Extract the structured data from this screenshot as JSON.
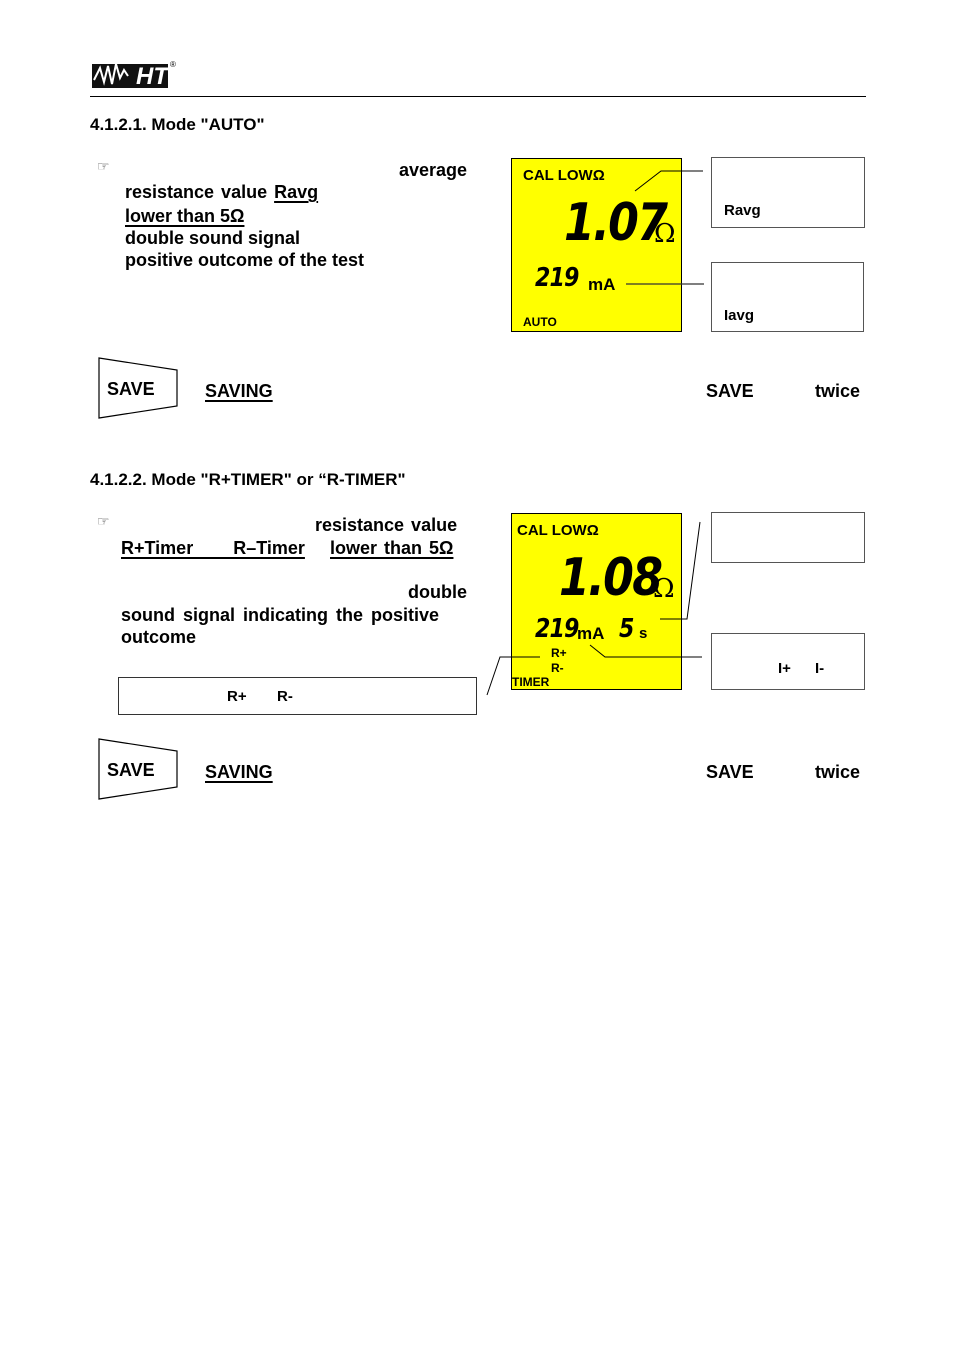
{
  "header": {
    "logo_text": "HT",
    "logo_mark": "®"
  },
  "section1": {
    "heading": "4.1.2.1.    Mode \"AUTO\"",
    "note_icon": "pointing-hand-icon",
    "paragraph": {
      "line1": "average",
      "line2a": "resistance  value ",
      "line2b": "Ravg",
      "line3": "lower  than  5Ω",
      "line4": "double   sound   signal",
      "line5": "positive   outcome   of   the   test"
    },
    "lcd": {
      "mode_label": "CAL LOWΩ",
      "resistance_value": "1.07",
      "resistance_unit": "Ω",
      "current_value": "219",
      "current_unit": "mA",
      "footer_label": "AUTO",
      "background_color": "#ffff00"
    },
    "callouts": [
      {
        "label": "Ravg"
      },
      {
        "label": "Iavg"
      }
    ],
    "save_row": {
      "key_label": "SAVE",
      "saving_link": "SAVING",
      "save_word": "SAVE",
      "twice_word": "twice"
    }
  },
  "section2": {
    "heading": "4.1.2.2.    Mode \"R+TIMER\" or “R-TIMER\"",
    "note_icon": "pointing-hand-icon",
    "paragraph": {
      "line1": "resistance  value",
      "line2a": "R+Timer        R–Timer",
      "line2b": "lower  than  5Ω",
      "line3": "double",
      "line4": "sound  signal  indicating  the  positive",
      "line5": "outcome"
    },
    "terminal_box": {
      "r_plus": "R+",
      "r_minus": "R-"
    },
    "lcd": {
      "mode_label": "CAL LOWΩ",
      "resistance_value": "1.08",
      "resistance_unit": "Ω",
      "current_value": "219",
      "current_unit": "mA",
      "time_value": "5",
      "time_unit": "s",
      "r_plus": "R+",
      "r_minus": "R-",
      "footer_label": "TIMER",
      "background_color": "#ffff00"
    },
    "callouts": [
      {
        "label": ""
      },
      {
        "i_plus": "I+",
        "i_minus": "I-"
      }
    ],
    "save_row": {
      "key_label": "SAVE",
      "saving_link": "SAVING",
      "save_word": "SAVE",
      "twice_word": "twice"
    }
  }
}
